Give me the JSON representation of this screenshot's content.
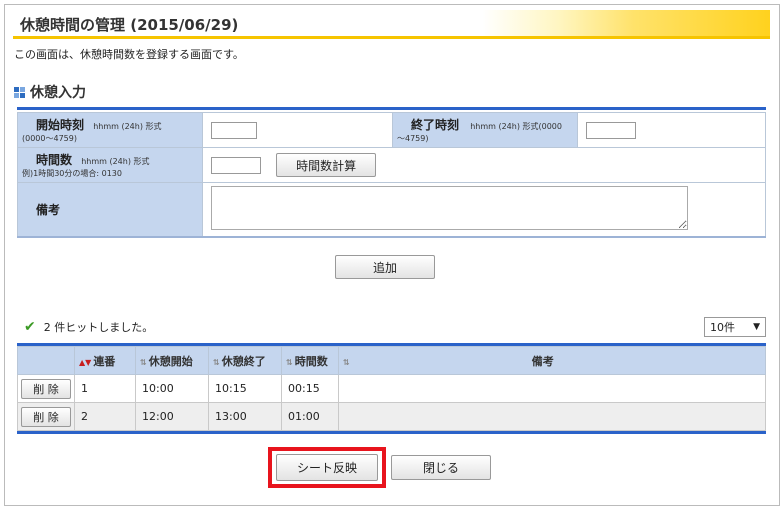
{
  "page": {
    "title": "休憩時間の管理 (2015/06/29)",
    "description": "この画面は、休憩時間数を登録する画面です。"
  },
  "form_section": {
    "heading": "休憩入力",
    "start_label": "開始時刻",
    "start_hint_a": "hhmm (24h) 形式",
    "start_hint_b": "(0000〜4759)",
    "start_value": "",
    "end_label": "終了時刻",
    "end_hint_a": "hhmm (24h) 形式(0000",
    "end_hint_b": "〜4759)",
    "end_value": "",
    "hours_label": "時間数",
    "hours_hint_a": "hhmm (24h) 形式",
    "hours_hint_b": "例)1時間30分の場合: 0130",
    "hours_value": "",
    "calc_button": "時間数計算",
    "note_label": "備考",
    "note_value": "",
    "add_button": "追加"
  },
  "results": {
    "hit_text": "2 件ヒットしました。",
    "page_size": "10件",
    "columns": [
      "連番",
      "休憩開始",
      "休憩終了",
      "時間数",
      "備考"
    ],
    "delete_label": "削 除",
    "rows": [
      {
        "no": "1",
        "start": "10:00",
        "end": "10:15",
        "hours": "00:15",
        "note": ""
      },
      {
        "no": "2",
        "start": "12:00",
        "end": "13:00",
        "hours": "01:00",
        "note": ""
      }
    ]
  },
  "footer": {
    "sheet_button": "シート反映",
    "close_button": "閉じる",
    "highlight_color": "#e8141d"
  }
}
